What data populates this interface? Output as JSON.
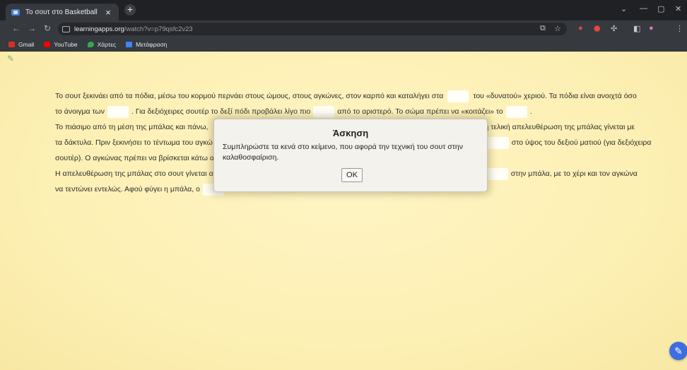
{
  "browser": {
    "tab_title": "Το σουτ στο Basketball",
    "tab_close": "×",
    "new_tab": "+",
    "window_controls": [
      "⌄",
      "—",
      "▢",
      "✕"
    ],
    "url_host": "learningapps.org",
    "url_path": "/watch?v=p79qsfc2v23",
    "bookmarks": [
      {
        "label": "Gmail",
        "icon": "gmail-icon",
        "color": "#d93025"
      },
      {
        "label": "YouTube",
        "icon": "youtube-icon",
        "color": "#ff0000"
      },
      {
        "label": "Χάρτες",
        "icon": "maps-icon",
        "color": "#34a853"
      },
      {
        "label": "Μετάφραση",
        "icon": "translate-icon",
        "color": "#4285f4"
      }
    ]
  },
  "exercise": {
    "lines": [
      {
        "a": "Το σουτ ξεκινάει από τα πόδια, μέσω του κορμού περνάει στους ώμους, στους αγκώνες, στον καρπό και καταλήγει στα",
        "b": "του «δυνατού» χεριού. Τα πόδια είναι ανοιχτά όσο"
      },
      {
        "a": "το άνοιγμα των",
        "b": ". Για δεξιόχειρες σουτέρ το δεξί πόδι προβάλει λίγο πιο",
        "c": "από το αριστερό. Το σώμα πρέπει να «κοιτάζει» το",
        "d": "."
      },
      {
        "a": "Το πιάσιμο από τη μέση της μπάλας και πάνω, ",
        "b": "η τελική απελευθέρωση της μπάλας γίνεται με"
      },
      {
        "a": "τα δάκτυλα. Πριν ξεκινήσει το τέντωμα του αγκώ",
        "b": "στο ύψος του δεξιού ματιού (για δεξιόχειρα"
      },
      {
        "a": "σουτέρ). Ο αγκώνας πρέπει να βρίσκεται κάτω α"
      },
      {
        "a": "Η απελευθέρωση της μπάλας στο σουτ γίνεται α",
        "b": "στην μπάλα, με το χέρι και τον αγκώνα"
      },
      {
        "a": "να τεντώνει εντελώς. Αφού φύγει η μπάλα, ο"
      }
    ]
  },
  "dialog": {
    "title": "Άσκηση",
    "text": "Συμπληρώστε τα κενά στο κείμενο, που αφορά την τεχνική του σουτ στην καλαθοσφαίριση.",
    "ok_label": "OK"
  },
  "fab_icon": "check-edit-icon"
}
